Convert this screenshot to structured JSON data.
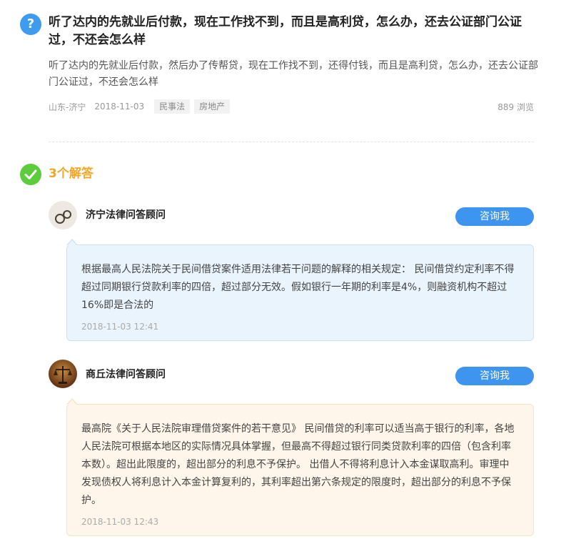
{
  "question": {
    "icon": "?",
    "title": "听了达内的先就业后付款，现在工作找不到，而且是高利贷，怎么办，还去公证部门公证过，不还会怎么样",
    "description": "听了达内的先就业后付款，然后办了传帮贷，现在工作找不到，还得付钱，而且是高利贷，怎么办，还去公证部门公证过，不还会怎么样",
    "location": "山东-济宁",
    "date": "2018-11-03",
    "tags": [
      "民事法",
      "房地产"
    ],
    "views": "889 浏览"
  },
  "answers_header": {
    "count_label": "3个解答"
  },
  "answers": [
    {
      "lawyer_name": "济宁法律问答顾问",
      "button_label": "咨询我",
      "text": "根据最高人民法院关于民间借贷案件适用法律若干问题的解释的相关规定： 民间借贷约定利率不得超过同期银行贷款利率的四倍，超过部分无效。假如银行一年期的利率是4%，则融资机构不超过16%即是合法的",
      "time": "2018-11-03 12:41"
    },
    {
      "lawyer_name": "商丘法律问答顾问",
      "button_label": "咨询我",
      "text": "最高院《关于人民法院审理借贷案件的若干意见》 民间借贷的利率可以适当高于银行的利率，各地人民法院可根据本地区的实际情况具体掌握，但最高不得超过银行同类贷款利率的四倍（包含利率本数）。超出此限度的，超出部分的利息不予保护。 出借人不得将利息计入本金谋取高利。审理中发现债权人将利息计入本金计算复利的，其利率超出第六条规定的限度时，超出部分的利息不予保护。",
      "time": "2018-11-03 12:43"
    }
  ],
  "colors": {
    "accent_blue": "#3d95f0",
    "answer_green": "#5dcc3c",
    "answer_count_orange": "#f5a623"
  }
}
